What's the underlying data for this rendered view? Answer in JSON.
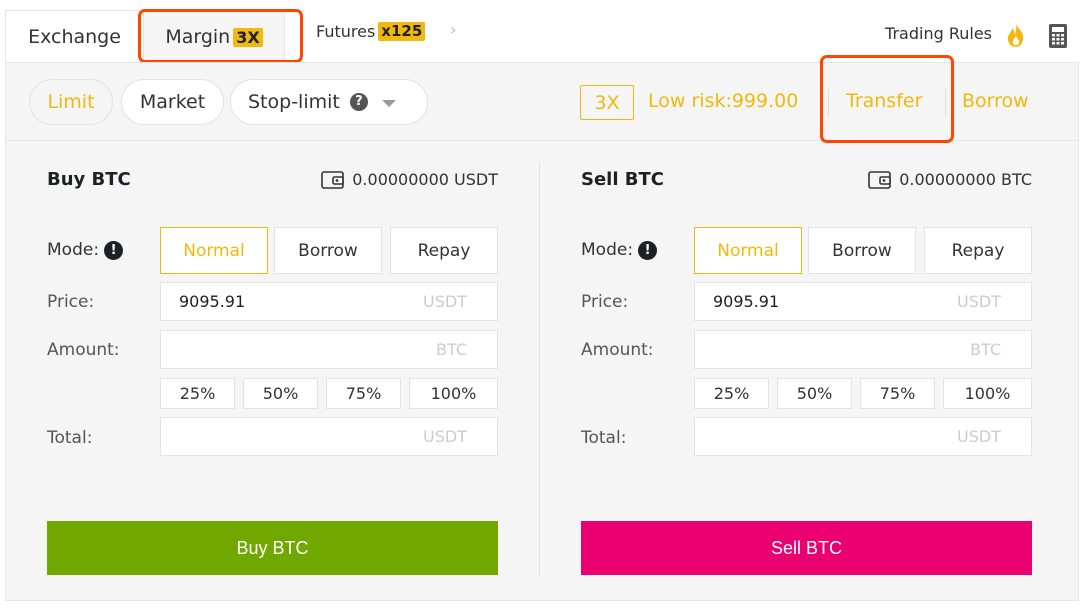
{
  "tabs": {
    "exchange": "Exchange",
    "margin": "Margin",
    "margin_badge": "3X",
    "futures": "Futures",
    "futures_badge": "x125",
    "more_chevron": "›"
  },
  "header_right": {
    "trading_rules": "Trading Rules"
  },
  "order_types": {
    "limit": "Limit",
    "market": "Market",
    "stop_limit": "Stop-limit",
    "help_glyph": "?"
  },
  "margin_info": {
    "leverage": "3X",
    "risk": "Low risk:999.00",
    "transfer": "Transfer",
    "borrow": "Borrow"
  },
  "colors": {
    "accent": "#f0b90b",
    "buy": "#70a800",
    "sell": "#ea0070",
    "highlight": "#ff4500"
  },
  "buy": {
    "title": "Buy BTC",
    "balance": "0.00000000 USDT",
    "mode_label": "Mode:",
    "mode_icon": "!",
    "modes": [
      "Normal",
      "Borrow",
      "Repay"
    ],
    "price_label": "Price:",
    "price_value": "9095.91",
    "price_unit": "USDT",
    "amount_label": "Amount:",
    "amount_value": "",
    "amount_unit": "BTC",
    "percents": [
      "25%",
      "50%",
      "75%",
      "100%"
    ],
    "total_label": "Total:",
    "total_value": "",
    "total_unit": "USDT",
    "submit": "Buy BTC"
  },
  "sell": {
    "title": "Sell BTC",
    "balance": "0.00000000 BTC",
    "mode_label": "Mode:",
    "mode_icon": "!",
    "modes": [
      "Normal",
      "Borrow",
      "Repay"
    ],
    "price_label": "Price:",
    "price_value": "9095.91",
    "price_unit": "USDT",
    "amount_label": "Amount:",
    "amount_value": "",
    "amount_unit": "BTC",
    "percents": [
      "25%",
      "50%",
      "75%",
      "100%"
    ],
    "total_label": "Total:",
    "total_value": "",
    "total_unit": "USDT",
    "submit": "Sell BTC"
  }
}
